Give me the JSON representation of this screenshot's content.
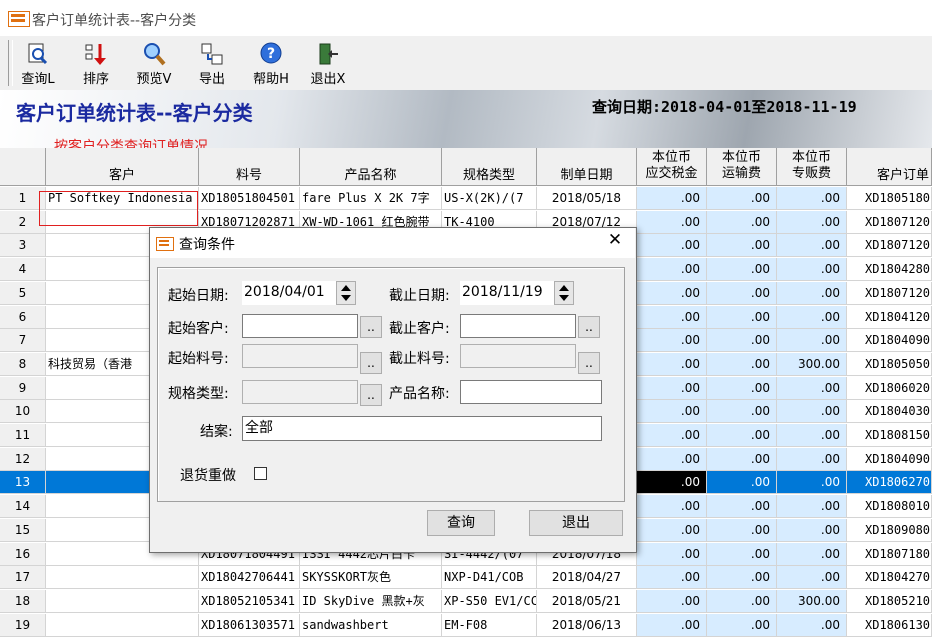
{
  "window": {
    "title": "客户订单统计表--客户分类"
  },
  "toolbar": [
    {
      "label": "查询L",
      "icon": "query-icon"
    },
    {
      "label": "排序",
      "icon": "sort-icon"
    },
    {
      "label": "预览V",
      "icon": "preview-icon"
    },
    {
      "label": "导出",
      "icon": "export-icon"
    },
    {
      "label": "帮助H",
      "icon": "help-icon"
    },
    {
      "label": "退出X",
      "icon": "exit-icon"
    }
  ],
  "banner": {
    "title": "客户订单统计表--客户分类",
    "query_date": "查询日期:2018-04-01至2018-11-19",
    "subtitle": "按客户分类查询订单情况"
  },
  "grid": {
    "headers": [
      "客户",
      "料号",
      "产品名称",
      "规格类型",
      "制单日期",
      "本位币\n应交税金",
      "本位币\n运输费",
      "本位币\n专贩费",
      "客户订单"
    ],
    "rows": [
      {
        "n": "1",
        "customer": "PT Softkey Indonesia",
        "part": "XD18051804501",
        "name": "fare Plus X 2K 7字",
        "spec": "US-X(2K)/(7",
        "date": "2018/05/18",
        "tax": ".00",
        "ship": ".00",
        "fee": ".00",
        "order": "XD1805180"
      },
      {
        "n": "2",
        "customer": "",
        "part": "XD18071202871",
        "name": "XW-WD-1061 红色腕带",
        "spec": "TK-4100",
        "date": "2018/07/12",
        "tax": ".00",
        "ship": ".00",
        "fee": ".00",
        "order": "XD1807120"
      },
      {
        "n": "3",
        "customer": "",
        "part": "",
        "name": "",
        "spec": "",
        "date": "",
        "tax": ".00",
        "ship": ".00",
        "fee": ".00",
        "order": "XD1807120"
      },
      {
        "n": "4",
        "customer": "",
        "part": "",
        "name": "",
        "spec": "",
        "date": "",
        "tax": ".00",
        "ship": ".00",
        "fee": ".00",
        "order": "XD1804280"
      },
      {
        "n": "5",
        "customer": "",
        "part": "",
        "name": "",
        "spec": "",
        "date": "",
        "tax": ".00",
        "ship": ".00",
        "fee": ".00",
        "order": "XD1807120"
      },
      {
        "n": "6",
        "customer": "",
        "part": "",
        "name": "",
        "spec": "",
        "date": "",
        "tax": ".00",
        "ship": ".00",
        "fee": ".00",
        "order": "XD1804120"
      },
      {
        "n": "7",
        "customer": "",
        "part": "",
        "name": "",
        "spec": "",
        "date": "",
        "tax": ".00",
        "ship": ".00",
        "fee": ".00",
        "order": "XD1804090"
      },
      {
        "n": "8",
        "customer": "科技贸易（香港",
        "part": "",
        "name": "",
        "spec": "",
        "date": "",
        "tax": ".00",
        "ship": ".00",
        "fee": "300.00",
        "order": "XD1805050"
      },
      {
        "n": "9",
        "customer": "",
        "part": "",
        "name": "",
        "spec": "",
        "date": "",
        "tax": ".00",
        "ship": ".00",
        "fee": ".00",
        "order": "XD1806020"
      },
      {
        "n": "10",
        "customer": "",
        "part": "",
        "name": "",
        "spec": "",
        "date": "",
        "tax": ".00",
        "ship": ".00",
        "fee": ".00",
        "order": "XD1804030"
      },
      {
        "n": "11",
        "customer": "",
        "part": "",
        "name": "",
        "spec": "",
        "date": "",
        "tax": ".00",
        "ship": ".00",
        "fee": ".00",
        "order": "XD1808150"
      },
      {
        "n": "12",
        "customer": "",
        "part": "",
        "name": "",
        "spec": "",
        "date": "",
        "tax": ".00",
        "ship": ".00",
        "fee": ".00",
        "order": "XD1804090"
      },
      {
        "n": "13",
        "customer": "",
        "part": "",
        "name": "",
        "spec": "",
        "date": "",
        "tax": ".00",
        "ship": ".00",
        "fee": ".00",
        "order": "XD1806270"
      },
      {
        "n": "14",
        "customer": "",
        "part": "",
        "name": "",
        "spec": "",
        "date": "",
        "tax": ".00",
        "ship": ".00",
        "fee": ".00",
        "order": "XD1808010"
      },
      {
        "n": "15",
        "customer": "",
        "part": "",
        "name": "",
        "spec": "",
        "date": "",
        "tax": ".00",
        "ship": ".00",
        "fee": ".00",
        "order": "XD1809080"
      },
      {
        "n": "16",
        "customer": "",
        "part": "XD18071804491",
        "name": "ISSI 4442芯片白卡",
        "spec": "SI-4442/(07",
        "date": "2018/07/18",
        "tax": ".00",
        "ship": ".00",
        "fee": ".00",
        "order": "XD1807180"
      },
      {
        "n": "17",
        "customer": "",
        "part": "XD18042706441",
        "name": "SKYSSKORT灰色",
        "spec": "NXP-D41/COB",
        "date": "2018/04/27",
        "tax": ".00",
        "ship": ".00",
        "fee": ".00",
        "order": "XD1804270"
      },
      {
        "n": "18",
        "customer": "",
        "part": "XD18052105341",
        "name": "ID SkyDive 黑款+灰",
        "spec": "XP-S50 EV1/CC",
        "date": "2018/05/21",
        "tax": ".00",
        "ship": ".00",
        "fee": "300.00",
        "order": "XD1805210"
      },
      {
        "n": "19",
        "customer": "",
        "part": "XD18061303571",
        "name": "sandwashbert",
        "spec": "EM-F08",
        "date": "2018/06/13",
        "tax": ".00",
        "ship": ".00",
        "fee": ".00",
        "order": "XD1806130"
      }
    ]
  },
  "dialog": {
    "title": "查询条件",
    "start_date_label": "起始日期:",
    "start_date": "2018/04/01",
    "end_date_label": "截止日期:",
    "end_date": "2018/11/19",
    "start_customer_label": "起始客户:",
    "end_customer_label": "截止客户:",
    "start_part_label": "起始料号:",
    "end_part_label": "截止料号:",
    "spec_label": "规格类型:",
    "product_label": "产品名称:",
    "close_label": "结案:",
    "close_value": "全部",
    "return_label": "退货重做",
    "query_button": "查询",
    "exit_button": "退出",
    "dots": "..",
    "close_glyph": "✕"
  },
  "colors": {
    "banner_title": "#1b2aa0",
    "subtitle": "#e02020",
    "selection": "#0078d7",
    "cell_blue": "#d7ecff"
  }
}
